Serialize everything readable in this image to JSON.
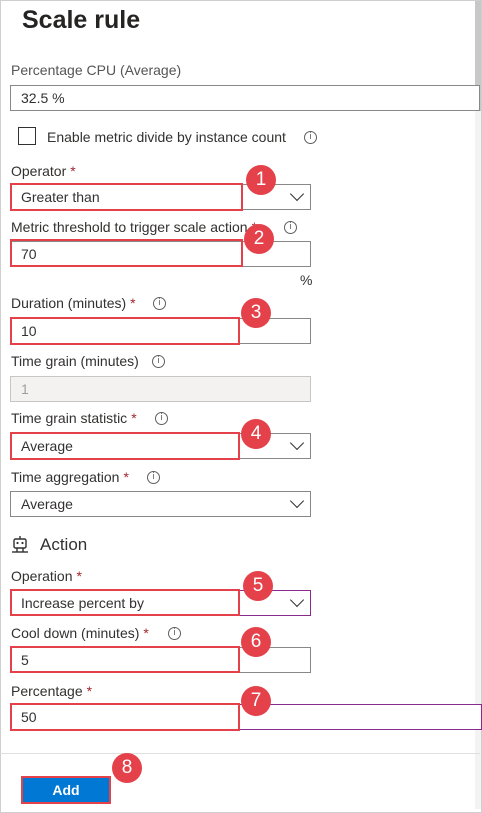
{
  "title": "Scale rule",
  "metric_label": "Percentage CPU (Average)",
  "metric_value": "32.5 %",
  "enable_divide_label": "Enable metric divide by instance count",
  "operator": {
    "label": "Operator",
    "value": "Greater than"
  },
  "threshold": {
    "label": "Metric threshold to trigger scale action",
    "value": "70",
    "unit": "%"
  },
  "duration": {
    "label": "Duration (minutes)",
    "value": "10"
  },
  "time_grain": {
    "label": "Time grain (minutes)",
    "value": "1"
  },
  "time_grain_statistic": {
    "label": "Time grain statistic",
    "value": "Average"
  },
  "time_aggregation": {
    "label": "Time aggregation",
    "value": "Average"
  },
  "action_heading": "Action",
  "operation": {
    "label": "Operation",
    "value": "Increase percent by"
  },
  "cool_down": {
    "label": "Cool down (minutes)",
    "value": "5"
  },
  "percentage": {
    "label": "Percentage",
    "value": "50"
  },
  "add_button": "Add",
  "required_mark": "*",
  "info_glyph": "i",
  "badges": [
    "1",
    "2",
    "3",
    "4",
    "5",
    "6",
    "7",
    "8"
  ],
  "colors": {
    "accent": "#0078d4",
    "highlight": "#e5414a",
    "required": "#a4262c"
  }
}
